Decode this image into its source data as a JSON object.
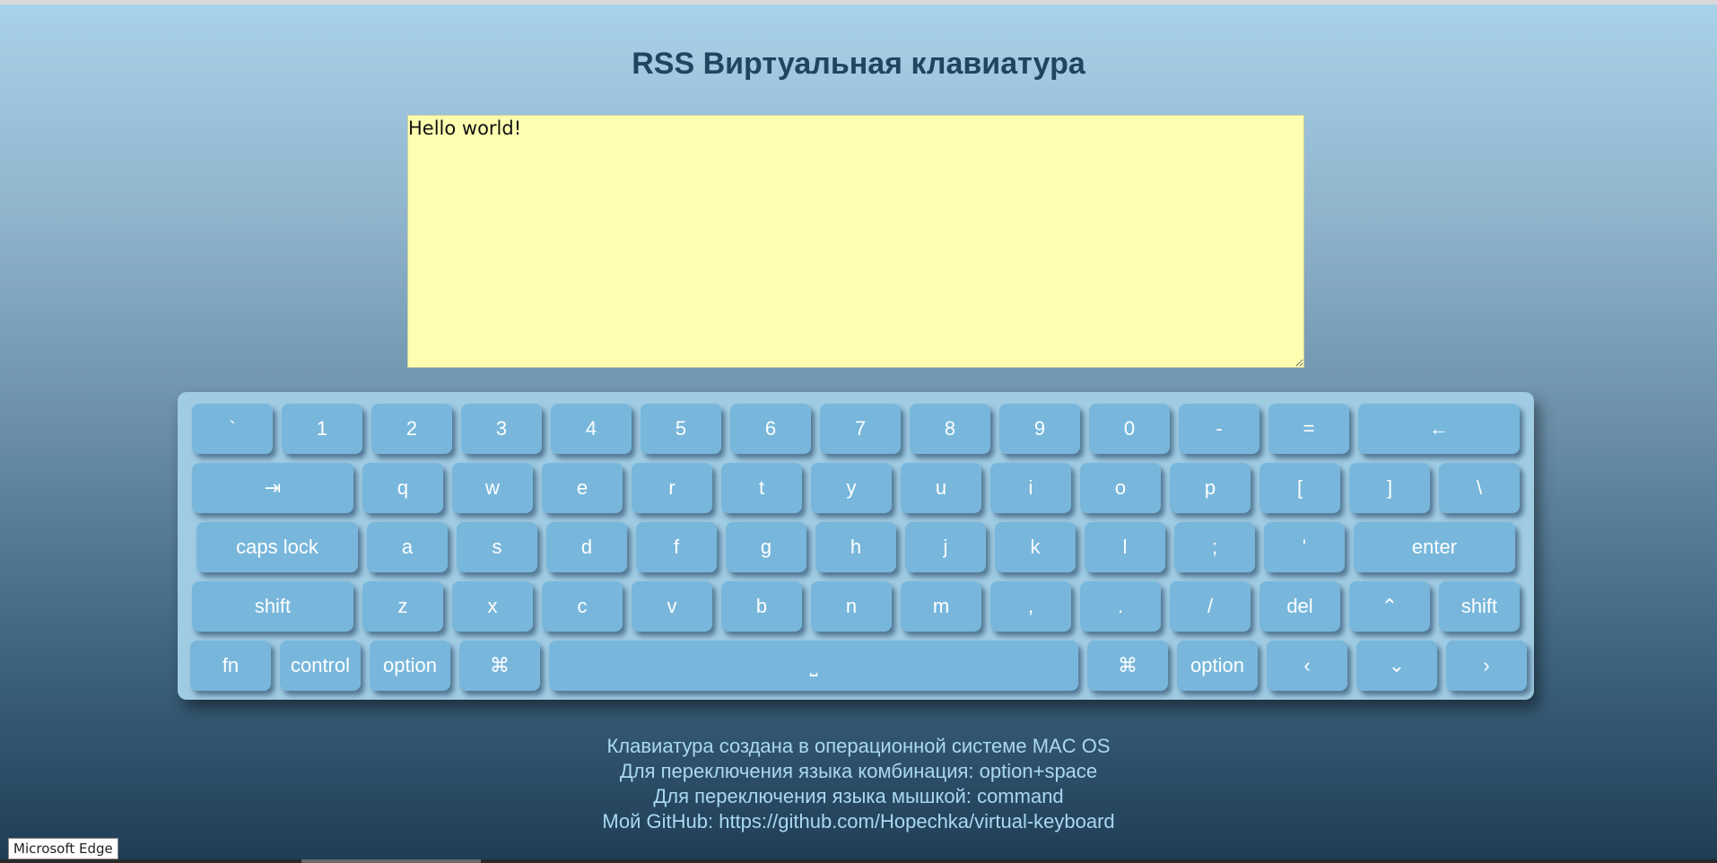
{
  "page": {
    "title": "RSS Виртуальная клавиатура",
    "textarea_value": "Hello world!"
  },
  "keyboard": {
    "rows": [
      [
        {
          "label": "`",
          "name": "key-backtick"
        },
        {
          "label": "1",
          "name": "key-1"
        },
        {
          "label": "2",
          "name": "key-2"
        },
        {
          "label": "3",
          "name": "key-3"
        },
        {
          "label": "4",
          "name": "key-4"
        },
        {
          "label": "5",
          "name": "key-5"
        },
        {
          "label": "6",
          "name": "key-6"
        },
        {
          "label": "7",
          "name": "key-7"
        },
        {
          "label": "8",
          "name": "key-8"
        },
        {
          "label": "9",
          "name": "key-9"
        },
        {
          "label": "0",
          "name": "key-0"
        },
        {
          "label": "-",
          "name": "key-minus"
        },
        {
          "label": "=",
          "name": "key-equal"
        },
        {
          "label": "←",
          "name": "key-backspace"
        }
      ],
      [
        {
          "label": "⇥",
          "name": "key-tab"
        },
        {
          "label": "q",
          "name": "key-q"
        },
        {
          "label": "w",
          "name": "key-w"
        },
        {
          "label": "e",
          "name": "key-e"
        },
        {
          "label": "r",
          "name": "key-r"
        },
        {
          "label": "t",
          "name": "key-t"
        },
        {
          "label": "y",
          "name": "key-y"
        },
        {
          "label": "u",
          "name": "key-u"
        },
        {
          "label": "i",
          "name": "key-i"
        },
        {
          "label": "o",
          "name": "key-o"
        },
        {
          "label": "p",
          "name": "key-p"
        },
        {
          "label": "[",
          "name": "key-bracket-left"
        },
        {
          "label": "]",
          "name": "key-bracket-right"
        },
        {
          "label": "\\",
          "name": "key-backslash"
        }
      ],
      [
        {
          "label": "caps lock",
          "name": "key-caps-lock"
        },
        {
          "label": "a",
          "name": "key-a"
        },
        {
          "label": "s",
          "name": "key-s"
        },
        {
          "label": "d",
          "name": "key-d"
        },
        {
          "label": "f",
          "name": "key-f"
        },
        {
          "label": "g",
          "name": "key-g"
        },
        {
          "label": "h",
          "name": "key-h"
        },
        {
          "label": "j",
          "name": "key-j"
        },
        {
          "label": "k",
          "name": "key-k"
        },
        {
          "label": "l",
          "name": "key-l"
        },
        {
          "label": ";",
          "name": "key-semicolon"
        },
        {
          "label": "'",
          "name": "key-quote"
        },
        {
          "label": "enter",
          "name": "key-enter"
        }
      ],
      [
        {
          "label": "shift",
          "name": "key-shift-left"
        },
        {
          "label": "z",
          "name": "key-z"
        },
        {
          "label": "x",
          "name": "key-x"
        },
        {
          "label": "c",
          "name": "key-c"
        },
        {
          "label": "v",
          "name": "key-v"
        },
        {
          "label": "b",
          "name": "key-b"
        },
        {
          "label": "n",
          "name": "key-n"
        },
        {
          "label": "m",
          "name": "key-m"
        },
        {
          "label": ",",
          "name": "key-comma"
        },
        {
          "label": ".",
          "name": "key-period"
        },
        {
          "label": "/",
          "name": "key-slash"
        },
        {
          "label": "del",
          "name": "key-delete"
        },
        {
          "label": "⌃",
          "name": "key-arrow-up"
        },
        {
          "label": "shift",
          "name": "key-shift-right"
        }
      ],
      [
        {
          "label": "fn",
          "name": "key-fn"
        },
        {
          "label": "control",
          "name": "key-control"
        },
        {
          "label": "option",
          "name": "key-option-left"
        },
        {
          "label": "⌘",
          "name": "key-command-left"
        },
        {
          "label": "⎵",
          "name": "key-space"
        },
        {
          "label": "⌘",
          "name": "key-command-right"
        },
        {
          "label": "option",
          "name": "key-option-right"
        },
        {
          "label": "‹",
          "name": "key-arrow-left"
        },
        {
          "label": "⌄",
          "name": "key-arrow-down"
        },
        {
          "label": "›",
          "name": "key-arrow-right"
        }
      ]
    ]
  },
  "footer": {
    "line1": "Клавиатура создана в операционной системе MAC OS",
    "line2": "Для переключения языка комбинация: option+space",
    "line3": "Для переключения языка мышкой: command",
    "line4": "Мой GitHub: https://github.com/Hopechka/virtual-keyboard"
  },
  "browser": {
    "badge": "Microsoft Edge"
  }
}
